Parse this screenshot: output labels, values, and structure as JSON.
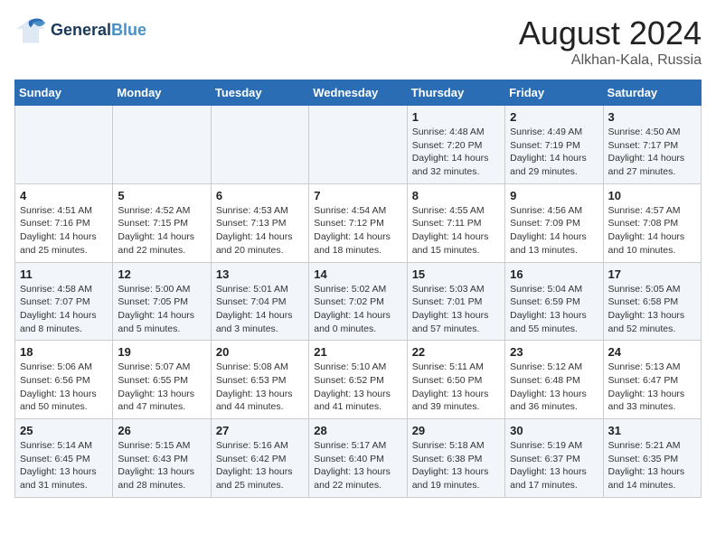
{
  "header": {
    "logo_line1": "General",
    "logo_line2": "Blue",
    "main_title": "August 2024",
    "subtitle": "Alkhan-Kala, Russia"
  },
  "days_of_week": [
    "Sunday",
    "Monday",
    "Tuesday",
    "Wednesday",
    "Thursday",
    "Friday",
    "Saturday"
  ],
  "weeks": [
    [
      {
        "day": "",
        "info": ""
      },
      {
        "day": "",
        "info": ""
      },
      {
        "day": "",
        "info": ""
      },
      {
        "day": "",
        "info": ""
      },
      {
        "day": "1",
        "info": "Sunrise: 4:48 AM\nSunset: 7:20 PM\nDaylight: 14 hours\nand 32 minutes."
      },
      {
        "day": "2",
        "info": "Sunrise: 4:49 AM\nSunset: 7:19 PM\nDaylight: 14 hours\nand 29 minutes."
      },
      {
        "day": "3",
        "info": "Sunrise: 4:50 AM\nSunset: 7:17 PM\nDaylight: 14 hours\nand 27 minutes."
      }
    ],
    [
      {
        "day": "4",
        "info": "Sunrise: 4:51 AM\nSunset: 7:16 PM\nDaylight: 14 hours\nand 25 minutes."
      },
      {
        "day": "5",
        "info": "Sunrise: 4:52 AM\nSunset: 7:15 PM\nDaylight: 14 hours\nand 22 minutes."
      },
      {
        "day": "6",
        "info": "Sunrise: 4:53 AM\nSunset: 7:13 PM\nDaylight: 14 hours\nand 20 minutes."
      },
      {
        "day": "7",
        "info": "Sunrise: 4:54 AM\nSunset: 7:12 PM\nDaylight: 14 hours\nand 18 minutes."
      },
      {
        "day": "8",
        "info": "Sunrise: 4:55 AM\nSunset: 7:11 PM\nDaylight: 14 hours\nand 15 minutes."
      },
      {
        "day": "9",
        "info": "Sunrise: 4:56 AM\nSunset: 7:09 PM\nDaylight: 14 hours\nand 13 minutes."
      },
      {
        "day": "10",
        "info": "Sunrise: 4:57 AM\nSunset: 7:08 PM\nDaylight: 14 hours\nand 10 minutes."
      }
    ],
    [
      {
        "day": "11",
        "info": "Sunrise: 4:58 AM\nSunset: 7:07 PM\nDaylight: 14 hours\nand 8 minutes."
      },
      {
        "day": "12",
        "info": "Sunrise: 5:00 AM\nSunset: 7:05 PM\nDaylight: 14 hours\nand 5 minutes."
      },
      {
        "day": "13",
        "info": "Sunrise: 5:01 AM\nSunset: 7:04 PM\nDaylight: 14 hours\nand 3 minutes."
      },
      {
        "day": "14",
        "info": "Sunrise: 5:02 AM\nSunset: 7:02 PM\nDaylight: 14 hours\nand 0 minutes."
      },
      {
        "day": "15",
        "info": "Sunrise: 5:03 AM\nSunset: 7:01 PM\nDaylight: 13 hours\nand 57 minutes."
      },
      {
        "day": "16",
        "info": "Sunrise: 5:04 AM\nSunset: 6:59 PM\nDaylight: 13 hours\nand 55 minutes."
      },
      {
        "day": "17",
        "info": "Sunrise: 5:05 AM\nSunset: 6:58 PM\nDaylight: 13 hours\nand 52 minutes."
      }
    ],
    [
      {
        "day": "18",
        "info": "Sunrise: 5:06 AM\nSunset: 6:56 PM\nDaylight: 13 hours\nand 50 minutes."
      },
      {
        "day": "19",
        "info": "Sunrise: 5:07 AM\nSunset: 6:55 PM\nDaylight: 13 hours\nand 47 minutes."
      },
      {
        "day": "20",
        "info": "Sunrise: 5:08 AM\nSunset: 6:53 PM\nDaylight: 13 hours\nand 44 minutes."
      },
      {
        "day": "21",
        "info": "Sunrise: 5:10 AM\nSunset: 6:52 PM\nDaylight: 13 hours\nand 41 minutes."
      },
      {
        "day": "22",
        "info": "Sunrise: 5:11 AM\nSunset: 6:50 PM\nDaylight: 13 hours\nand 39 minutes."
      },
      {
        "day": "23",
        "info": "Sunrise: 5:12 AM\nSunset: 6:48 PM\nDaylight: 13 hours\nand 36 minutes."
      },
      {
        "day": "24",
        "info": "Sunrise: 5:13 AM\nSunset: 6:47 PM\nDaylight: 13 hours\nand 33 minutes."
      }
    ],
    [
      {
        "day": "25",
        "info": "Sunrise: 5:14 AM\nSunset: 6:45 PM\nDaylight: 13 hours\nand 31 minutes."
      },
      {
        "day": "26",
        "info": "Sunrise: 5:15 AM\nSunset: 6:43 PM\nDaylight: 13 hours\nand 28 minutes."
      },
      {
        "day": "27",
        "info": "Sunrise: 5:16 AM\nSunset: 6:42 PM\nDaylight: 13 hours\nand 25 minutes."
      },
      {
        "day": "28",
        "info": "Sunrise: 5:17 AM\nSunset: 6:40 PM\nDaylight: 13 hours\nand 22 minutes."
      },
      {
        "day": "29",
        "info": "Sunrise: 5:18 AM\nSunset: 6:38 PM\nDaylight: 13 hours\nand 19 minutes."
      },
      {
        "day": "30",
        "info": "Sunrise: 5:19 AM\nSunset: 6:37 PM\nDaylight: 13 hours\nand 17 minutes."
      },
      {
        "day": "31",
        "info": "Sunrise: 5:21 AM\nSunset: 6:35 PM\nDaylight: 13 hours\nand 14 minutes."
      }
    ]
  ]
}
